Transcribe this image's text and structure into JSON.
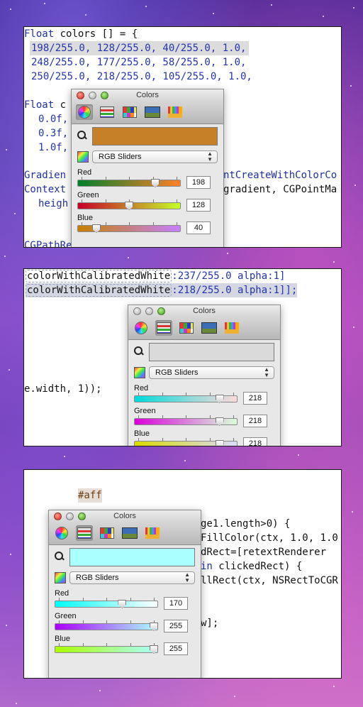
{
  "panel1": {
    "code": {
      "l1_kw": "Float",
      "l1_rest": " colors [] = {",
      "l2": [
        {
          "n": "198",
          "s": "/",
          "d": "255.0"
        },
        {
          "t": ", "
        },
        {
          "n": "128",
          "s": "/",
          "d": "255.0"
        },
        {
          "t": ", "
        },
        {
          "n": "40",
          "s": "/",
          "d": "255.0"
        },
        {
          "t": ", "
        },
        {
          "n": "1.0",
          "s": ",",
          "d": ""
        }
      ],
      "l2_text": "198/255.0, 128/255.0, 40/255.0, 1.0,",
      "l3_text": "248/255.0, 177/255.0, 58/255.0, 1.0,",
      "l4_text": "250/255.0, 218/255.0, 105/255.0, 1.0,",
      "l5_kw": "Float",
      "l5_rest": " c",
      "l6": "0.0f,",
      "l7": "0.3f,",
      "l8": "1.0f,",
      "l9_left": "Gradien",
      "l9_right": "ntCreateWithColorCo",
      "l10_left": "Context",
      "l10_right": "gradient, CGPointMa",
      "l11_left": "heigh",
      "l12_left": "CGPathRe"
    },
    "picker": {
      "title": "Colors",
      "mode": "RGB Sliders",
      "swatch_color": "#c68028",
      "sliders": [
        {
          "label": "Red",
          "value": "198",
          "fraction": 0.776,
          "gradient": [
            "#00802a",
            "#ff8028"
          ]
        },
        {
          "label": "Green",
          "value": "128",
          "fraction": 0.502,
          "gradient": [
            "#c60028",
            "#c6ff28"
          ]
        },
        {
          "label": "Blue",
          "value": "40",
          "fraction": 0.157,
          "gradient": [
            "#c68000",
            "#c680ff"
          ]
        }
      ]
    }
  },
  "panel2": {
    "code": {
      "l1_prefix": "[",
      "l1_method": "colorWithCalibratedWhite",
      "l1_args": ":237/255.0 alpha:1]",
      "l2_method": "colorWithCalibratedWhite",
      "l2_args": ":218/255.0 alpha:1]];",
      "l3": "e.width, 1));"
    },
    "picker": {
      "title": "Colors",
      "mode": "RGB Sliders",
      "swatch_color": "#dadada",
      "sliders": [
        {
          "label": "Red",
          "value": "218",
          "fraction": 0.855,
          "gradient": [
            "#00dada",
            "#ffdada"
          ]
        },
        {
          "label": "Green",
          "value": "218",
          "fraction": 0.855,
          "gradient": [
            "#da00da",
            "#daffda"
          ]
        },
        {
          "label": "Blue",
          "value": "218",
          "fraction": 0.855,
          "gradient": [
            "#dada00",
            "#dadaff"
          ]
        }
      ]
    }
  },
  "panel3": {
    "code": {
      "hash_text": "#aff",
      "r1": "ge1.length>0) {",
      "r2": "FillColor(ctx, 1.0, 1.0",
      "r3": "dRect=[retextRenderer ",
      "r4_kw": "in",
      "r4_rest": " clickedRect) {",
      "r5": "llRect(ctx, NSRectToCGR",
      "r6": "w];"
    },
    "picker": {
      "title": "Colors",
      "mode": "RGB Sliders",
      "swatch_color": "#aaffff",
      "sliders": [
        {
          "label": "Red",
          "value": "170",
          "fraction": 0.667,
          "gradient": [
            "#00ffff",
            "#ffffff"
          ]
        },
        {
          "label": "Green",
          "value": "255",
          "fraction": 1.0,
          "gradient": [
            "#aa00ff",
            "#aaffff"
          ]
        },
        {
          "label": "Blue",
          "value": "255",
          "fraction": 1.0,
          "gradient": [
            "#aaff00",
            "#aaffff"
          ]
        }
      ]
    }
  }
}
